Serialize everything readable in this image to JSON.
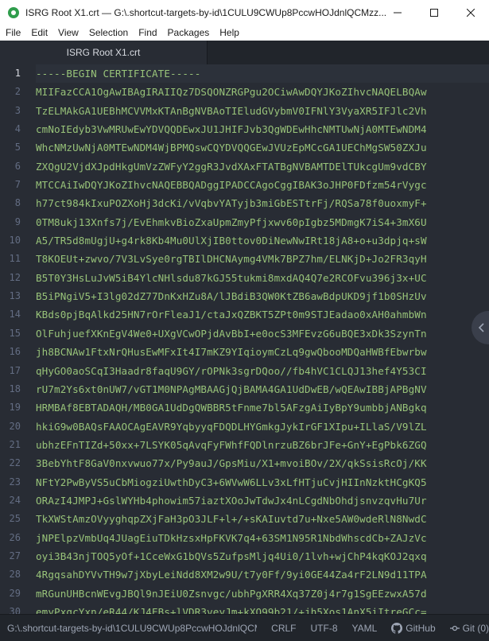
{
  "window": {
    "title": "ISRG Root X1.crt — G:\\.shortcut-targets-by-id\\1CULU9CWUp8PccwHOJdnlQCMzz..."
  },
  "menu": [
    "File",
    "Edit",
    "View",
    "Selection",
    "Find",
    "Packages",
    "Help"
  ],
  "tab": {
    "label": "ISRG Root X1.crt"
  },
  "editor": {
    "current_line": 1,
    "lines": [
      "-----BEGIN CERTIFICATE-----",
      "MIIFazCCA1OgAwIBAgIRAIIQz7DSQONZRGPgu2OCiwAwDQYJKoZIhvcNAQELBQAw",
      "TzELMAkGA1UEBhMCVVMxKTAnBgNVBAoTIEludGVybmV0IFNlY3VyaXR5IFJlc2Vh",
      "cmNoIEdyb3VwMRUwEwYDVQQDEwxJU1JHIFJvb3QgWDEwHhcNMTUwNjA0MTEwNDM4",
      "WhcNMzUwNjA0MTEwNDM4WjBPMQswCQYDVQQGEwJVUzEpMCcGA1UEChMgSW50ZXJu",
      "ZXQgU2VjdXJpdHkgUmVzZWFyY2ggR3JvdXAxFTATBgNVBAMTDElTUkcgUm9vdCBY",
      "MTCCAiIwDQYJKoZIhvcNAQEBBQADggIPADCCAgoCggIBAK3oJHP0FDfzm54rVygc",
      "h77ct984kIxuPOZXoHj3dcKi/vVqbvYATyjb3miGbESTtrFj/RQSa78f0uoxmyF+",
      "0TM8ukj13Xnfs7j/EvEhmkvBioZxaUpmZmyPfjxwv60pIgbz5MDmgK7iS4+3mX6U",
      "A5/TR5d8mUgjU+g4rk8Kb4Mu0UlXjIB0ttov0DiNewNwIRt18jA8+o+u3dpjq+sW",
      "T8KOEUt+zwvo/7V3LvSye0rgTBIlDHCNAymg4VMk7BPZ7hm/ELNKjD+Jo2FR3qyH",
      "B5T0Y3HsLuJvW5iB4YlcNHlsdu87kGJ55tukmi8mxdAQ4Q7e2RCOFvu396j3x+UC",
      "B5iPNgiV5+I3lg02dZ77DnKxHZu8A/lJBdiB3QW0KtZB6awBdpUKD9jf1b0SHzUv",
      "KBds0pjBqAlkd25HN7rOrFleaJ1/ctaJxQZBKT5ZPt0m9STJEadao0xAH0ahmbWn",
      "OlFuhjuefXKnEgV4We0+UXgVCwOPjdAvBbI+e0ocS3MFEvzG6uBQE3xDk3SzynTn",
      "jh8BCNAw1FtxNrQHusEwMFxIt4I7mKZ9YIqioymCzLq9gwQbooMDQaHWBfEbwrbw",
      "qHyGO0aoSCqI3Haadr8faqU9GY/rOPNk3sgrDQoo//fb4hVC1CLQJ13hef4Y53CI",
      "rU7m2Ys6xt0nUW7/vGT1M0NPAgMBAAGjQjBAMA4GA1UdDwEB/wQEAwIBBjAPBgNV",
      "HRMBAf8EBTADAQH/MB0GA1UdDgQWBBR5tFnme7bl5AFzgAiIyBpY9umbbjANBgkq",
      "hkiG9w0BAQsFAAOCAgEAVR9YqbyyqFDQDLHYGmkgJykIrGF1XIpu+ILlaS/V9lZL",
      "ubhzEFnTIZd+50xx+7LSYK05qAvqFyFWhfFQDlnrzuBZ6brJFe+GnY+EgPbk6ZGQ",
      "3BebYhtF8GaV0nxvwuo77x/Py9auJ/GpsMiu/X1+mvoiBOv/2X/qkSsisRcOj/KK",
      "NFtY2PwByVS5uCbMiogziUwthDyC3+6WVwW6LLv3xLfHTjuCvjHIInNzktHCgKQ5",
      "ORAzI4JMPJ+GslWYHb4phowim57iaztXOoJwTdwJx4nLCgdNbOhdjsnvzqvHu7Ur",
      "TkXWStAmzOVyyghqpZXjFaH3pO3JLF+l+/+sKAIuvtd7u+Nxe5AW0wdeRlN8NwdC",
      "jNPElpzVmbUq4JUagEiuTDkHzsxHpFKVK7q4+63SM1N95R1NbdWhscdCb+ZAJzVc",
      "oyi3B43njTOQ5yOf+1CceWxG1bQVs5ZufpsMljq4Ui0/1lvh+wjChP4kqKOJ2qxq",
      "4RgqsahDYVvTH9w7jXbyLeiNdd8XM2w9U/t7y0Ff/9yi0GE44Za4rF2LN9d11TPA",
      "mRGunUHBcnWEvgJBQl9nJEiU0Zsnvgc/ubhPgXRR4Xq37Z0j4r7g1SgEEzwxA57d",
      "emyPxgcYxn/eR44/KJ4EBs+lVDR3veyJm+kXQ99b21/+jh5Xos1AnX5iItreGCc=",
      "-----END CERTIFICATE-----",
      ""
    ]
  },
  "status": {
    "path": "G:\\.shortcut-targets-by-id\\1CULU9CWUp8PccwHOJdnlQCMzz",
    "line_ending": "CRLF",
    "encoding": "UTF-8",
    "grammar": "YAML",
    "github": "GitHub",
    "git": "Git (0)"
  }
}
